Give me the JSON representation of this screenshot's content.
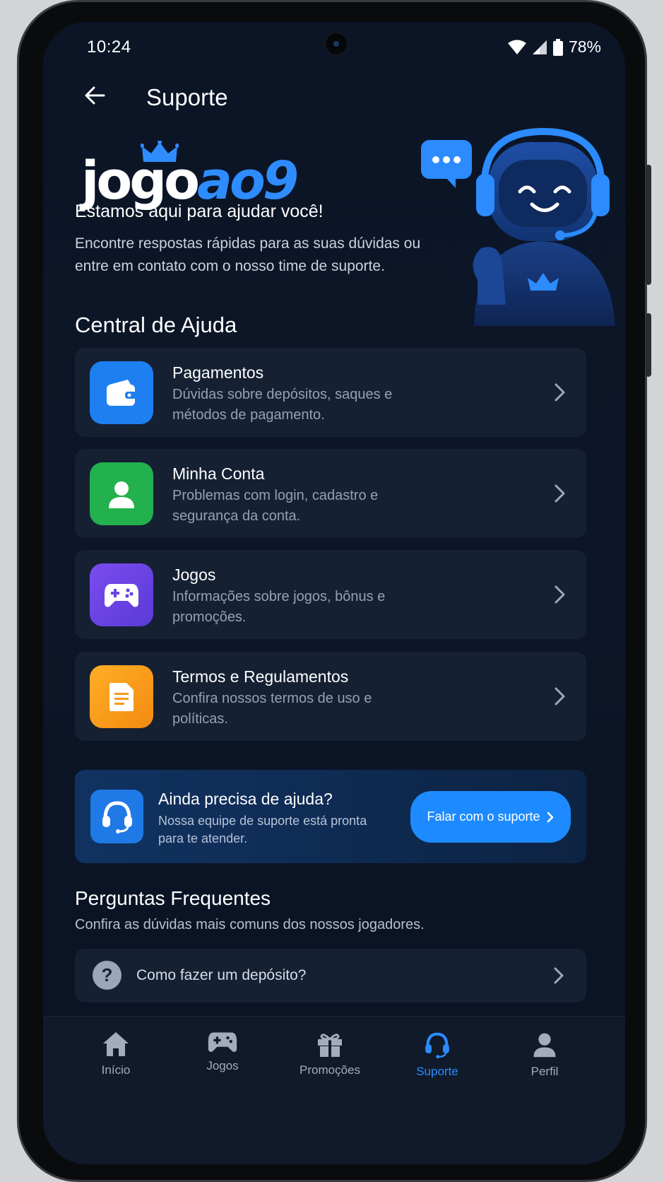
{
  "status_bar": {
    "time": "10:24",
    "battery": "78%"
  },
  "header": {
    "title": "Suporte"
  },
  "logo": {
    "part1": "jogo",
    "part2": "ao9"
  },
  "hero": {
    "title": "Estamos aqui para ajudar você!",
    "subtitle": "Encontre respostas rápidas para as suas dúvidas ou entre em contato com o nosso time de suporte."
  },
  "help_center": {
    "title": "Central de Ajuda",
    "items": [
      {
        "title": "Pagamentos",
        "desc": "Dúvidas sobre depósitos, saques e métodos de pagamento.",
        "icon": "wallet-icon",
        "color": "#1e7ff0"
      },
      {
        "title": "Minha Conta",
        "desc": "Problemas com login, cadastro e segurança da conta.",
        "icon": "user-icon",
        "color": "#22b14c"
      },
      {
        "title": "Jogos",
        "desc": "Informações sobre jogos, bônus e promoções.",
        "icon": "gamepad-icon",
        "color": "#6a45e0"
      },
      {
        "title": "Termos e Regulamentos",
        "desc": "Confira nossos termos de uso e políticas.",
        "icon": "document-icon",
        "color": "#f59a18"
      }
    ]
  },
  "support_banner": {
    "title": "Ainda precisa de ajuda?",
    "desc": "Nossa equipe de suporte está pronta para te atender.",
    "button": "Falar com o suporte"
  },
  "faq": {
    "title": "Perguntas Frequentes",
    "subtitle": "Confira as dúvidas mais comuns dos nossos jogadores.",
    "items": [
      {
        "question": "Como fazer um depósito?"
      }
    ]
  },
  "bottom_nav": {
    "items": [
      {
        "label": "Início",
        "icon": "home-icon"
      },
      {
        "label": "Jogos",
        "icon": "gamepad-icon"
      },
      {
        "label": "Promoções",
        "icon": "gift-icon"
      },
      {
        "label": "Suporte",
        "icon": "headset-icon",
        "active": true
      },
      {
        "label": "Perfil",
        "icon": "person-icon"
      }
    ]
  },
  "colors": {
    "accent": "#2a8cff",
    "background": "#0b1526",
    "card": "#152033"
  }
}
